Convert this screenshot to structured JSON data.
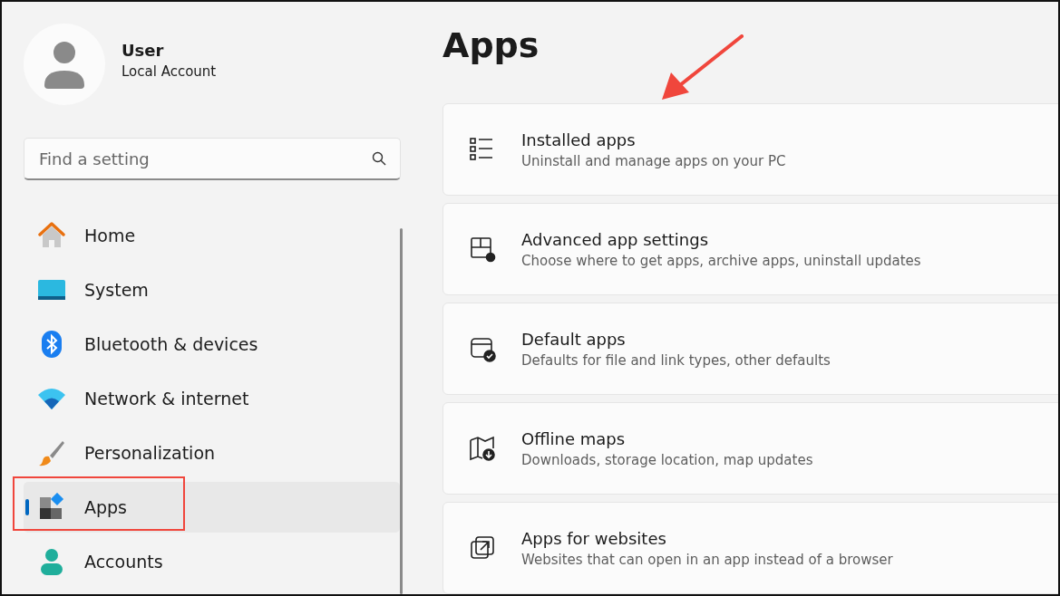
{
  "account": {
    "name": "User",
    "type": "Local Account"
  },
  "search": {
    "placeholder": "Find a setting"
  },
  "nav": [
    {
      "label": "Home",
      "selected": false
    },
    {
      "label": "System",
      "selected": false
    },
    {
      "label": "Bluetooth & devices",
      "selected": false
    },
    {
      "label": "Network & internet",
      "selected": false
    },
    {
      "label": "Personalization",
      "selected": false
    },
    {
      "label": "Apps",
      "selected": true
    },
    {
      "label": "Accounts",
      "selected": false
    }
  ],
  "page_title": "Apps",
  "cards": [
    {
      "title": "Installed apps",
      "subtitle": "Uninstall and manage apps on your PC"
    },
    {
      "title": "Advanced app settings",
      "subtitle": "Choose where to get apps, archive apps, uninstall updates"
    },
    {
      "title": "Default apps",
      "subtitle": "Defaults for file and link types, other defaults"
    },
    {
      "title": "Offline maps",
      "subtitle": "Downloads, storage location, map updates"
    },
    {
      "title": "Apps for websites",
      "subtitle": "Websites that can open in an app instead of a browser"
    }
  ]
}
